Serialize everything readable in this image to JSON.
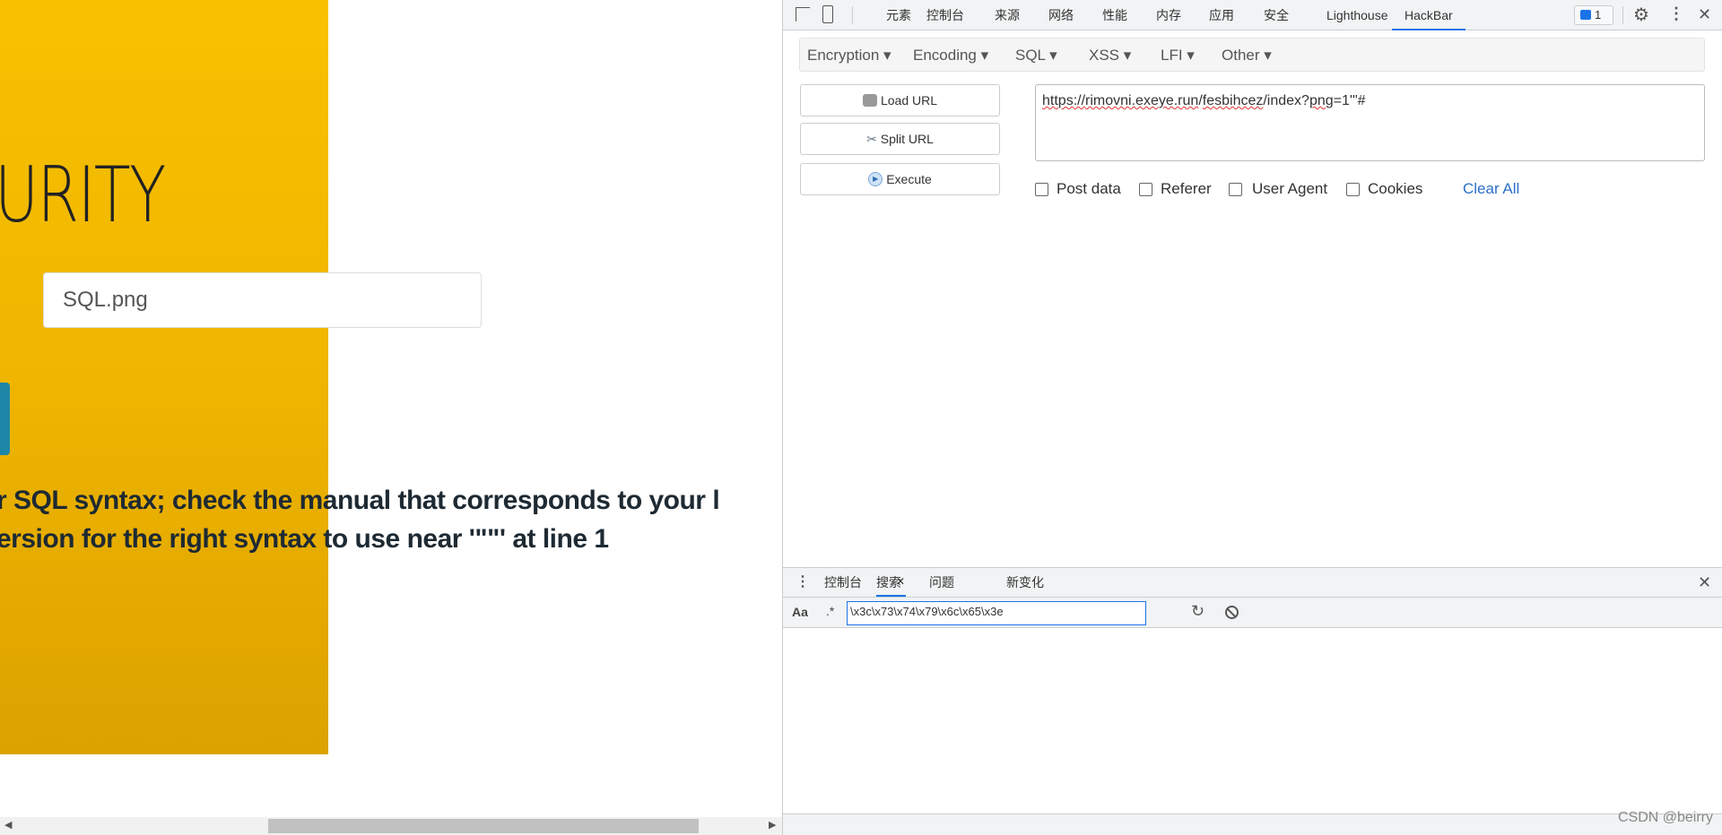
{
  "page": {
    "title": "URITY",
    "input_value": "SQL.png",
    "error_line1": "r SQL syntax; check the manual that corresponds to your l",
    "error_line2": "ersion for the right syntax to use near '\"\"' at line 1"
  },
  "devtools": {
    "tabs": [
      "元素",
      "控制台",
      "来源",
      "网络",
      "性能",
      "内存",
      "应用",
      "安全",
      "Lighthouse",
      "HackBar"
    ],
    "active_tab": "HackBar",
    "issues_count": "1"
  },
  "hackbar": {
    "menus": [
      "Encryption",
      "Encoding",
      "SQL",
      "XSS",
      "LFI",
      "Other"
    ],
    "load_url": "Load URL",
    "split_url": "Split URL",
    "execute": "Execute",
    "url_parts": [
      "https://",
      "rimovni.exeye.run",
      "/",
      "fesbihcez",
      "/index?",
      "png",
      "=1'\"#"
    ],
    "checkboxes": [
      "Post data",
      "Referer",
      "User Agent",
      "Cookies"
    ],
    "clear_all": "Clear All",
    "accent": "#1a73e8"
  },
  "drawer": {
    "tabs": [
      "控制台",
      "搜索",
      "问题",
      "新变化"
    ],
    "active_tab": "搜索",
    "match_case": "Aa",
    "regex": ".*",
    "search_value": "\\x3c\\x73\\x74\\x79\\x6c\\x65\\x3e"
  },
  "watermark": "CSDN @beirry"
}
